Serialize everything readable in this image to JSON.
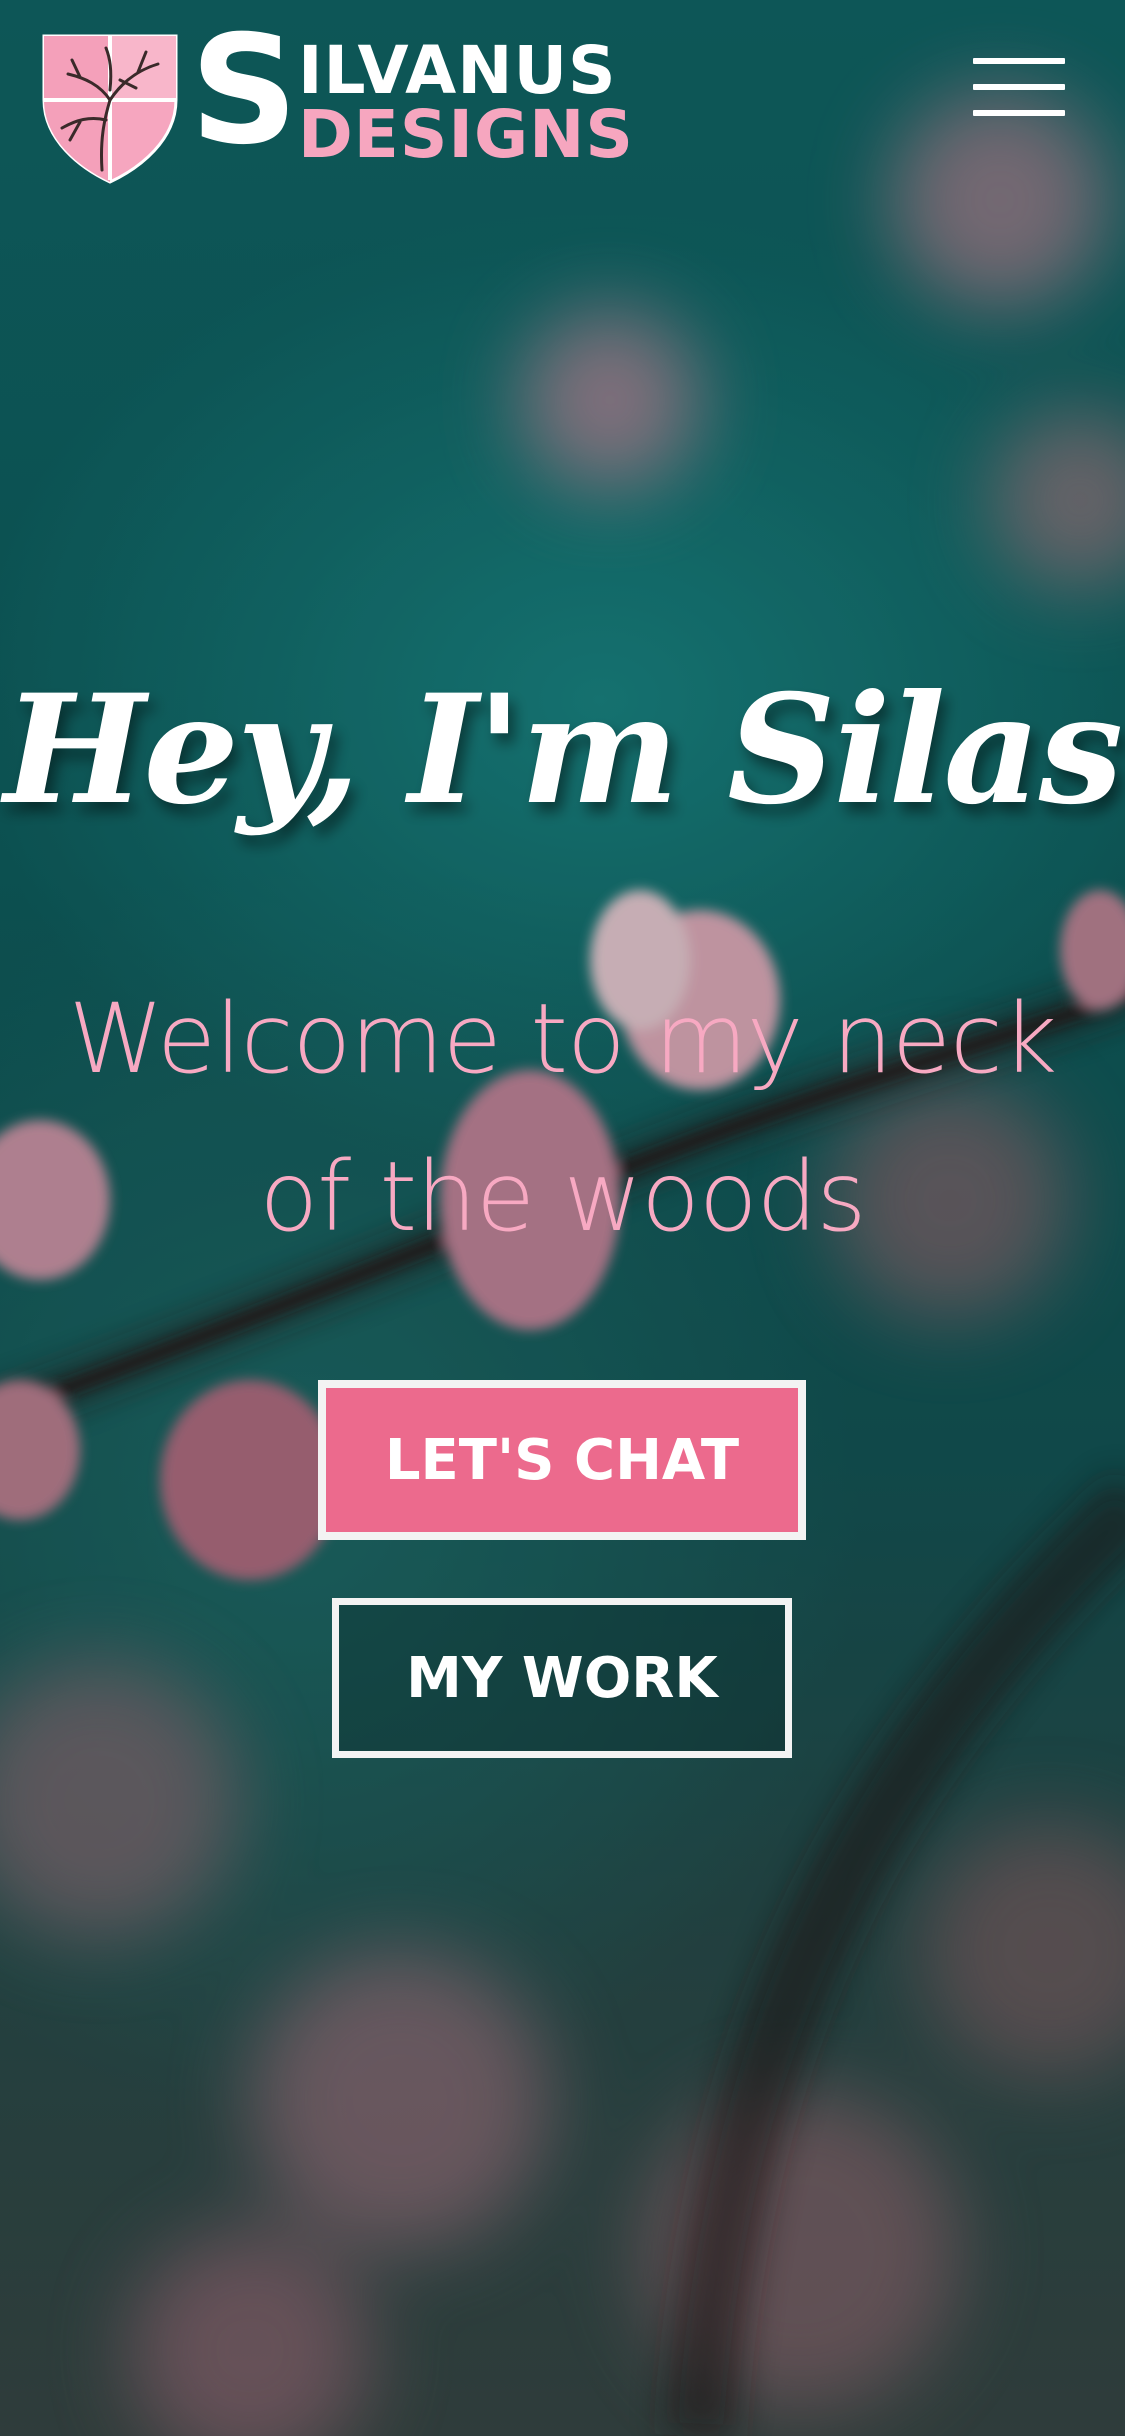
{
  "brand": {
    "initial": "S",
    "line1": "ILVANUS",
    "line2": "DESIGNS",
    "logo_icon": "tree-shield-icon"
  },
  "nav": {
    "menu_icon": "hamburger-menu-icon"
  },
  "hero": {
    "title": "Hey, I'm Silas",
    "subtitle_line1": "Welcome to my neck",
    "subtitle_line2": "of the woods"
  },
  "buttons": {
    "chat_label": "LET'S CHAT",
    "work_label": "MY WORK"
  },
  "colors": {
    "accent_pink": "#ec6a8d",
    "light_pink": "#f6a6bf",
    "background_teal": "#106a6b",
    "white": "#ffffff"
  }
}
